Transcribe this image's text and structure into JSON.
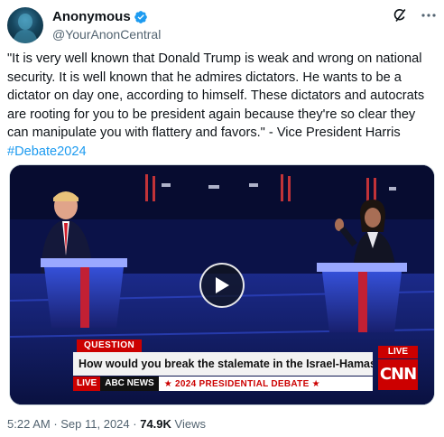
{
  "author": {
    "display_name": "Anonymous",
    "handle": "@YourAnonCentral",
    "verified": true
  },
  "header_icons": [
    "grok-icon",
    "more-icon"
  ],
  "tweet": {
    "text": "\"It is very well known that Donald Trump is weak and wrong on national security. It is well known that he admires dictators. He wants to be a dictator on day one, according to himself. These dictators and autocrats are rooting for you to be president again because they're so clear they can manipulate you with flattery and favors.\" - Vice President Harris",
    "hashtag": "#Debate2024"
  },
  "video": {
    "chyron_label": "QUESTION",
    "chyron_question": "How would you break the stalemate in the Israel-Hamas war?",
    "live_badge": "LIVE",
    "network_logo": "CNN",
    "strip_live": "LIVE",
    "strip_network": "ABC NEWS",
    "strip_event": "★ 2024 PRESIDENTIAL DEBATE ★"
  },
  "meta": {
    "time": "5:22 AM",
    "separator": " · ",
    "date": "Sep 11, 2024",
    "views_count": "74.9K",
    "views_label": " Views"
  },
  "colors": {
    "link": "#1d9bf0",
    "verified": "#1d9bf0",
    "text": "#0f1419",
    "secondary": "#536471",
    "cnn_red": "#cc0000"
  }
}
